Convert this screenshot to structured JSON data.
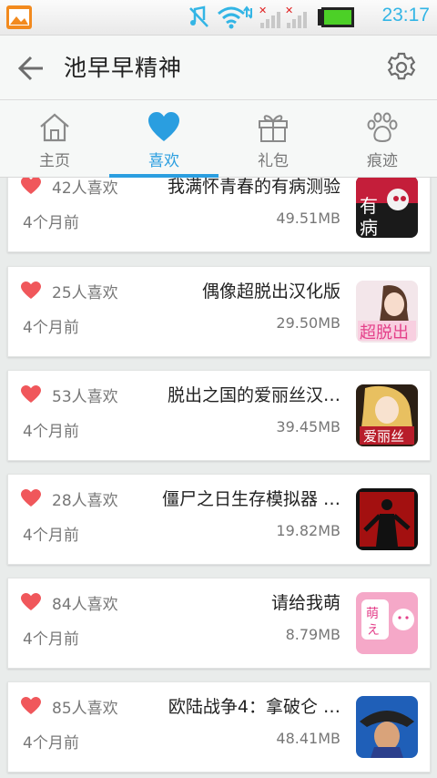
{
  "status_bar": {
    "time": "23:17",
    "icons": [
      "gallery-icon",
      "mute-icon",
      "wifi-icon",
      "signal-icon",
      "battery-icon"
    ]
  },
  "header": {
    "title": "池早早精神",
    "back_icon": "back-arrow-icon",
    "settings_icon": "gear-icon"
  },
  "tabs": [
    {
      "label": "主页",
      "icon": "home-icon",
      "active": false
    },
    {
      "label": "喜欢",
      "icon": "heart-icon",
      "active": true
    },
    {
      "label": "礼包",
      "icon": "gift-icon",
      "active": false
    },
    {
      "label": "痕迹",
      "icon": "paw-icon",
      "active": false
    }
  ],
  "colors": {
    "accent": "#2a9ee0",
    "heart": "#f0575b",
    "status_time": "#33b5e5"
  },
  "games": [
    {
      "likes": "42人喜欢",
      "time": "4个月前",
      "name": "我满怀青春的有病测验",
      "size": "49.51MB",
      "thumb": "youbing"
    },
    {
      "likes": "25人喜欢",
      "time": "4个月前",
      "name": "偶像超脱出汉化版",
      "size": "29.50MB",
      "thumb": "idol"
    },
    {
      "likes": "53人喜欢",
      "time": "4个月前",
      "name": "脱出之国的爱丽丝汉…",
      "size": "39.45MB",
      "thumb": "alice"
    },
    {
      "likes": "28人喜欢",
      "time": "4个月前",
      "name": "僵尸之日生存模拟器 …",
      "size": "19.82MB",
      "thumb": "zombie"
    },
    {
      "likes": "84人喜欢",
      "time": "4个月前",
      "name": "请给我萌",
      "size": "8.79MB",
      "thumb": "moe"
    },
    {
      "likes": "85人喜欢",
      "time": "4个月前",
      "name": "欧陆战争4：拿破仑 …",
      "size": "48.41MB",
      "thumb": "napoleon"
    }
  ]
}
